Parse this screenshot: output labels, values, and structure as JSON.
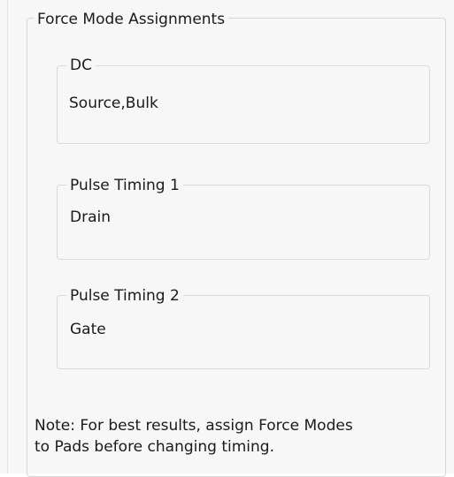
{
  "force_mode_assignments": {
    "title": "Force Mode Assignments",
    "groups": [
      {
        "label": "DC",
        "value": "Source,Bulk"
      },
      {
        "label": "Pulse Timing 1",
        "value": "Drain"
      },
      {
        "label": "Pulse Timing 2",
        "value": "Gate"
      }
    ],
    "note": {
      "line1": "Note: For best results, assign Force Modes",
      "line2": "to Pads before changing timing."
    }
  }
}
